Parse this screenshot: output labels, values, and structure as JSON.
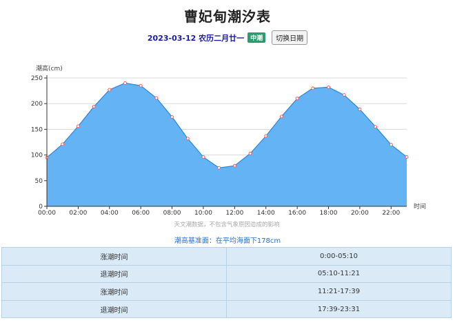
{
  "page": {
    "title": "曹妃甸潮汐表",
    "date": "2023-03-12 农历二月廿一",
    "tide_badge": "中潮",
    "switch_button": "切换日期",
    "baseline_note": "潮高基准面：在平均海面下178cm"
  },
  "chart_data": {
    "type": "area",
    "title": "",
    "ylabel": "潮高(cm)",
    "xlabel": "时间",
    "note": "天文潮数据，不包含气象原因造成的影响",
    "x": [
      "00:00",
      "01:00",
      "02:00",
      "03:00",
      "04:00",
      "05:00",
      "06:00",
      "07:00",
      "08:00",
      "09:00",
      "10:00",
      "11:00",
      "12:00",
      "13:00",
      "14:00",
      "15:00",
      "16:00",
      "17:00",
      "18:00",
      "19:00",
      "20:00",
      "21:00",
      "22:00",
      "23:00"
    ],
    "y": [
      95,
      121,
      156,
      194,
      227,
      240,
      235,
      211,
      174,
      132,
      96,
      75,
      79,
      103,
      137,
      175,
      210,
      230,
      232,
      217,
      189,
      155,
      120,
      96
    ],
    "xticks": [
      "00:00",
      "02:00",
      "04:00",
      "06:00",
      "08:00",
      "10:00",
      "12:00",
      "14:00",
      "16:00",
      "18:00",
      "20:00",
      "22:00"
    ],
    "yticks": [
      "0",
      "50",
      "100",
      "150",
      "200",
      "250"
    ],
    "ylim": [
      0,
      250
    ],
    "grid": true,
    "colors": {
      "fill": "#63b3f5",
      "line": "#2f86d9",
      "point": "#ff4d4d"
    }
  },
  "table": {
    "rows": [
      {
        "label": "涨潮时间",
        "value": "0:00-05:10"
      },
      {
        "label": "退潮时间",
        "value": "05:10-11:21"
      },
      {
        "label": "涨潮时间",
        "value": "11:21-17:39"
      },
      {
        "label": "退潮时间",
        "value": "17:39-23:31"
      }
    ]
  }
}
